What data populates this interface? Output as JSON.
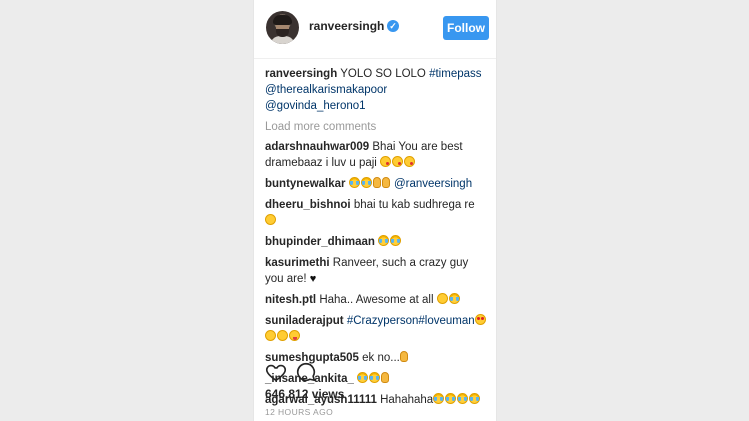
{
  "post": {
    "username": "ranveersingh",
    "follow_label": "Follow",
    "caption": {
      "user": "ranveersingh",
      "text": "YOLO SO LOLO",
      "hashtag": "#timepass",
      "mention1": "@therealkarismakapoor",
      "mention2": "@govinda_herono1"
    },
    "load_more": "Load more comments",
    "comments": [
      {
        "user": "adarshnauhwar009",
        "text": "Bhai You are best dramebaaz i luv u paji"
      },
      {
        "user": "buntynewalkar",
        "mention": "@ranveersingh"
      },
      {
        "user": "dheeru_bishnoi",
        "text": "bhai tu kab sudhrega re"
      },
      {
        "user": "bhupinder_dhimaan",
        "text": ""
      },
      {
        "user": "kasurimethi",
        "text": "Ranveer, such a crazy guy you are!"
      },
      {
        "user": "nitesh.ptl",
        "text": "Haha.. Awesome at all"
      },
      {
        "user": "suniladerajput",
        "hashtags": "#Crazyperson#loveuman"
      },
      {
        "user": "sumeshgupta505",
        "text": "ek no..."
      },
      {
        "user": "_insane_ankita_",
        "text": ""
      },
      {
        "user": "agarwal_ayush11111",
        "text": "Hahahaha"
      }
    ],
    "views": "646,812 views",
    "time": "12 HOURS AGO"
  },
  "colors": {
    "accent": "#3897f0",
    "link": "#003569",
    "muted": "#999999",
    "text": "#262626"
  }
}
